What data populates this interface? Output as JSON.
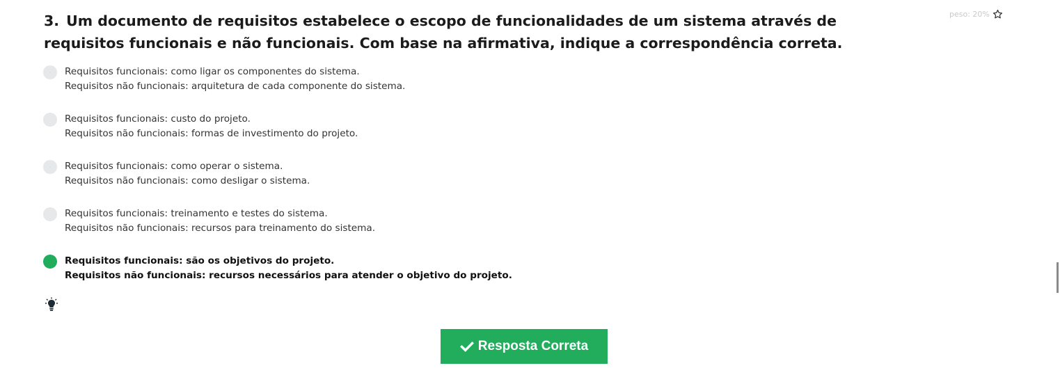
{
  "question": {
    "number": "3.",
    "text": "Um documento de requisitos estabelece o escopo de funcionalidades de um sistema através de requisitos funcionais e não funcionais. Com base na afirmativa, indique a correspondência correta."
  },
  "weight": {
    "label": "peso: 20%",
    "icon": "star-outline-icon"
  },
  "options": [
    {
      "line1": "Requisitos funcionais: como ligar os componentes do sistema.",
      "line2": "Requisitos não funcionais: arquitetura de cada componente do sistema.",
      "selected": false
    },
    {
      "line1": "Requisitos funcionais: custo do projeto.",
      "line2": "Requisitos não funcionais: formas de investimento do projeto.",
      "selected": false
    },
    {
      "line1": "Requisitos funcionais: como operar o sistema.",
      "line2": "Requisitos não funcionais: como desligar o sistema.",
      "selected": false
    },
    {
      "line1": "Requisitos funcionais: treinamento e testes do sistema.",
      "line2": "Requisitos não funcionais: recursos para treinamento do sistema.",
      "selected": false
    },
    {
      "line1": "Requisitos funcionais: são os objetivos do projeto.",
      "line2": "Requisitos não funcionais: recursos necessários para atender o objetivo do projeto.",
      "selected": true
    }
  ],
  "hint": {
    "icon": "lightbulb-icon"
  },
  "result_button": {
    "label": "Resposta Correta",
    "icon": "check-icon"
  },
  "colors": {
    "accent": "#22ad5c",
    "radio_unselected": "#e7e8ea",
    "weight_text": "#c9c9c9"
  }
}
